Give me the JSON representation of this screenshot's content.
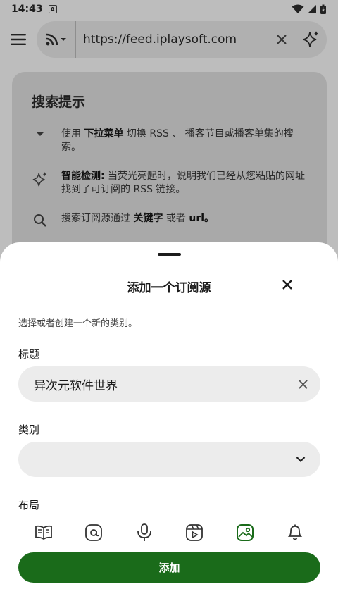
{
  "status_bar": {
    "time": "14:43",
    "notification_glyph": "A"
  },
  "url_bar": {
    "url": "https://feed.iplaysoft.com"
  },
  "hint_card": {
    "title": "搜索提示",
    "tips": [
      {
        "icon": "dropdown-arrow-icon",
        "before": "使用 ",
        "bold": "下拉菜单",
        "after": " 切换 RSS 、 播客节目或播客单集的搜索。"
      },
      {
        "icon": "sparkle-icon",
        "before": "",
        "bold": "智能检测:",
        "after": " 当荧光亮起时，说明我们已经从您粘贴的网址找到了可订阅的 RSS 链接。"
      },
      {
        "icon": "search-icon",
        "before": "搜索订阅源通过 ",
        "bold": "关键字",
        "after": " 或者 ",
        "bold2": "url。"
      }
    ]
  },
  "sheet": {
    "title": "添加一个订阅源",
    "subtitle": "选择或者创建一个新的类别。",
    "title_label": "标题",
    "title_value": "异次元软件世界",
    "category_label": "类别",
    "category_value": "",
    "layout_label": "布局",
    "layout_options": [
      {
        "icon": "book-icon",
        "selected": false
      },
      {
        "icon": "at-sign-icon",
        "selected": false
      },
      {
        "icon": "podcast-mic-icon",
        "selected": false
      },
      {
        "icon": "video-reel-icon",
        "selected": false
      },
      {
        "icon": "image-icon",
        "selected": true
      },
      {
        "icon": "notification-bell-icon",
        "selected": false
      }
    ],
    "add_button": "添加"
  },
  "colors": {
    "accent": "#1a6b1a",
    "scrim": "#bdbdbd",
    "field_bg": "#ececec"
  }
}
